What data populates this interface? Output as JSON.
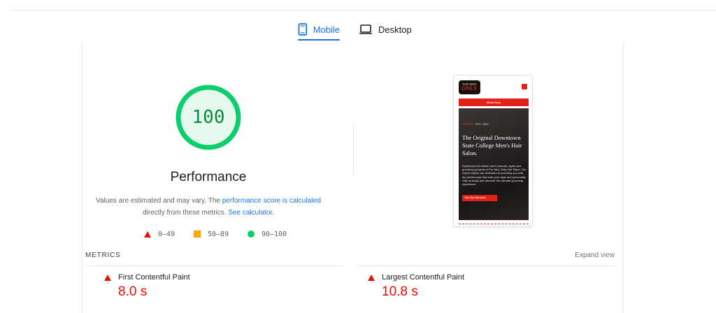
{
  "tabs": [
    {
      "label": "Mobile",
      "icon": "smartphone-icon",
      "selected": true
    },
    {
      "label": "Desktop",
      "icon": "laptop-icon",
      "selected": false
    }
  ],
  "gauge": {
    "score": "100",
    "score_fraction": 1.0,
    "color": "#0cce6b"
  },
  "category_title": "Performance",
  "note": {
    "prefix": "Values are estimated and may vary. The ",
    "link1": "performance score is calculated",
    "middle": " directly from these metrics. ",
    "link2": "See calculator."
  },
  "legend": [
    {
      "range": "0–49",
      "icon": "fail-triangle-icon",
      "color": "#eb0f00"
    },
    {
      "range": "50–89",
      "icon": "average-square-icon",
      "color": "#ffa400"
    },
    {
      "range": "90–100",
      "icon": "pass-circle-icon",
      "color": "#0cce6b"
    }
  ],
  "screenshot": {
    "logo_top": "FOR MEN",
    "logo_main": "ONLY",
    "book_button": "Book Now",
    "est": "EST. 2005",
    "headline": "The Original Downtown State College Men's Hair Salon.",
    "body": "Experience the finest men's haircuts, styles and grooming products at For Men Only Hair Salon. Our expert stylists are dedicated to providing you with the perfect look that suits your style and personality. Visit us today and discover the ultimate grooming experience",
    "cta": "See Our Services"
  },
  "metrics": {
    "heading": "METRICS",
    "expand": "Expand view",
    "items": [
      {
        "label": "First Contentful Paint",
        "value": "8.0 s"
      },
      {
        "label": "Largest Contentful Paint",
        "value": "10.8 s"
      }
    ]
  }
}
